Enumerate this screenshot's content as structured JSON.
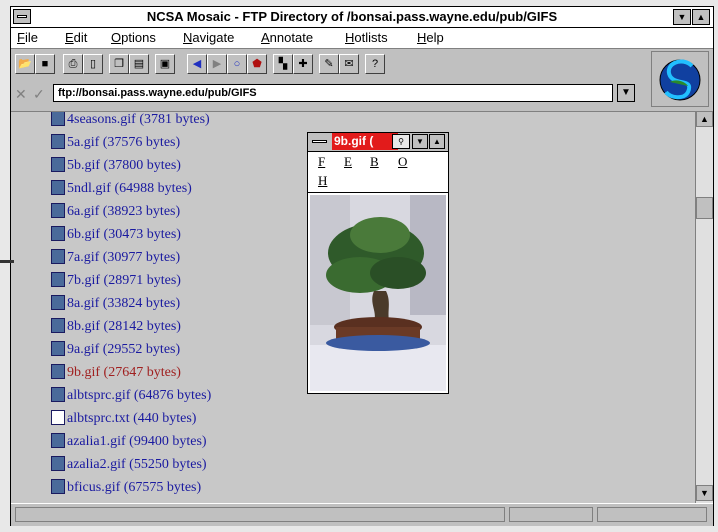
{
  "window": {
    "title": "NCSA Mosaic - FTP Directory of /bonsai.pass.wayne.edu/pub/GIFS"
  },
  "menu": {
    "items": [
      "File",
      "Edit",
      "Options",
      "Navigate",
      "Annotate",
      "Hotlists",
      "Help"
    ]
  },
  "address": {
    "url": "ftp://bonsai.pass.wayne.edu/pub/GIFS"
  },
  "files": [
    {
      "label": "4seasons.gif (3781 bytes)",
      "icon": "image-file-icon",
      "visited": false
    },
    {
      "label": "5a.gif (37576 bytes)",
      "icon": "image-file-icon",
      "visited": false
    },
    {
      "label": "5b.gif (37800 bytes)",
      "icon": "image-file-icon",
      "visited": false
    },
    {
      "label": "5ndl.gif (64988 bytes)",
      "icon": "image-file-icon",
      "visited": false
    },
    {
      "label": "6a.gif (38923 bytes)",
      "icon": "image-file-icon",
      "visited": false
    },
    {
      "label": "6b.gif (30473 bytes)",
      "icon": "image-file-icon",
      "visited": false
    },
    {
      "label": "7a.gif (30977 bytes)",
      "icon": "image-file-icon",
      "visited": false
    },
    {
      "label": "7b.gif (28971 bytes)",
      "icon": "image-file-icon",
      "visited": false
    },
    {
      "label": "8a.gif (33824 bytes)",
      "icon": "image-file-icon",
      "visited": false
    },
    {
      "label": "8b.gif (28142 bytes)",
      "icon": "image-file-icon",
      "visited": false
    },
    {
      "label": "9a.gif (29552 bytes)",
      "icon": "image-file-icon",
      "visited": false
    },
    {
      "label": "9b.gif (27647 bytes)",
      "icon": "image-file-icon",
      "visited": true
    },
    {
      "label": "albtsprc.gif (64876 bytes)",
      "icon": "image-file-icon",
      "visited": false
    },
    {
      "label": "albtsprc.txt (440 bytes)",
      "icon": "text-file-icon",
      "visited": false
    },
    {
      "label": "azalia1.gif (99400 bytes)",
      "icon": "image-file-icon",
      "visited": false
    },
    {
      "label": "azalia2.gif (55250 bytes)",
      "icon": "image-file-icon",
      "visited": false
    },
    {
      "label": "bficus.gif (67575 bytes)",
      "icon": "image-file-icon",
      "visited": false
    }
  ],
  "viewer": {
    "title": "9b.gif (",
    "menu": [
      "F",
      "E",
      "B",
      "O",
      "H"
    ]
  },
  "colors": {
    "link": "#1a1aa0",
    "visited_link": "#a02020",
    "viewer_title_bg": "#e21b1b"
  }
}
